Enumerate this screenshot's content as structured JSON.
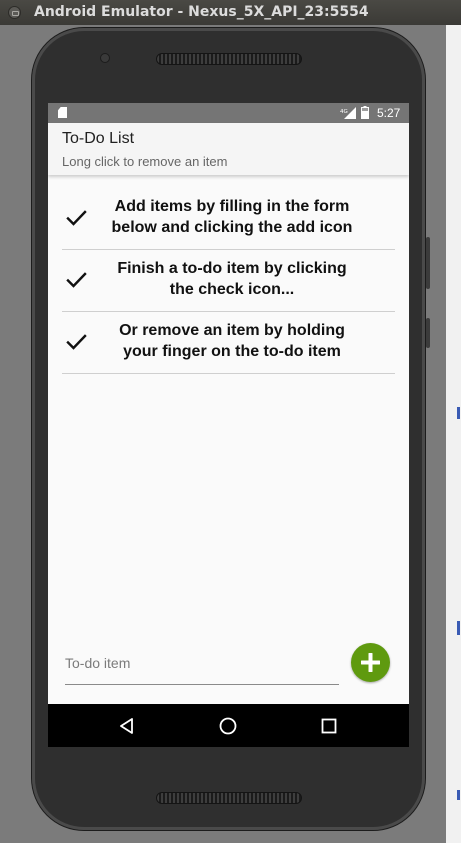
{
  "window": {
    "title": "Android Emulator - Nexus_5X_API_23:5554"
  },
  "status_bar": {
    "time": "5:27",
    "network": "4G"
  },
  "app_bar": {
    "title": "To-Do List",
    "subtitle": "Long click to remove an item"
  },
  "todos": [
    {
      "line1": "Add items by filling in the form",
      "line2": "below and clicking the add icon"
    },
    {
      "line1": "Finish a to-do item by clicking",
      "line2": "the check icon..."
    },
    {
      "line1": "Or remove an item by holding",
      "line2": "your finger on the to-do item"
    }
  ],
  "form": {
    "placeholder": "To-do item",
    "value": ""
  },
  "colors": {
    "accent": "#5f9a0f",
    "status_bar": "#757575",
    "app_bar": "#f5f5f5",
    "nav_bar": "#000000"
  },
  "icons": {
    "todo_check": "check-icon",
    "add": "add-circle-icon",
    "nav_back": "back-icon",
    "nav_home": "home-icon",
    "nav_recents": "recents-icon"
  }
}
